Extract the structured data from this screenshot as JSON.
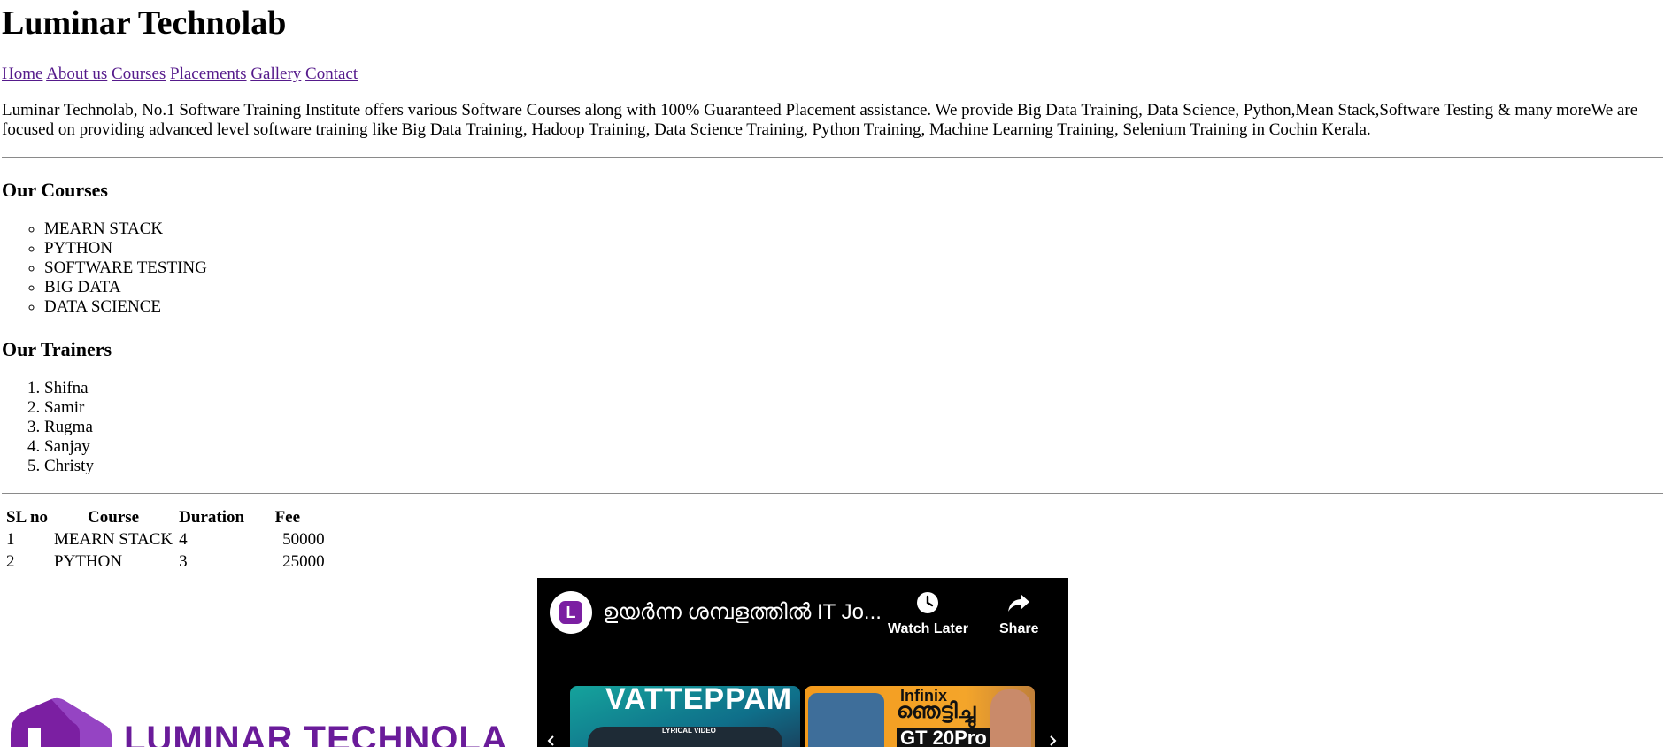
{
  "site": {
    "title": "Luminar Technolab"
  },
  "nav": {
    "items": [
      "Home",
      "About us",
      "Courses",
      "Placements",
      "Gallery",
      "Contact"
    ]
  },
  "intro": {
    "text": "Luminar Technolab, No.1 Software Training Institute offers various Software Courses along with 100% Guaranteed Placement assistance. We provide Big Data Training, Data Science, Python,Mean Stack,Software Testing & many moreWe are focused on providing advanced level software training like Big Data Training, Hadoop Training, Data Science Training, Python Training, Machine Learning Training, Selenium Training in Cochin Kerala."
  },
  "courses": {
    "heading": "Our Courses",
    "items": [
      "MEARN STACK",
      "PYTHON",
      "SOFTWARE TESTING",
      "BIG DATA",
      "DATA SCIENCE"
    ]
  },
  "trainers": {
    "heading": "Our Trainers",
    "items": [
      "Shifna",
      "Samir",
      "Rugma",
      "Sanjay",
      "Christy"
    ]
  },
  "table": {
    "headers": [
      "SL no",
      "Course",
      "Duration",
      "Fee"
    ],
    "rows": [
      [
        "1",
        "MEARN STACK",
        "4",
        "50000"
      ],
      [
        "2",
        "PYTHON",
        "3",
        "25000"
      ]
    ]
  },
  "logo": {
    "text": "LUMINAR TECHNOLAB",
    "color": "#6a1b9a"
  },
  "video": {
    "channel_initial": "L",
    "title": "ഉയർന്ന ശമ്പളത്തിൽ IT Jo...",
    "watch_later_label": "Watch Later",
    "share_label": "Share",
    "thumb1_title": "VATTEPPAM",
    "thumb1_sub": "LYRICAL VIDEO",
    "thumb2_brand": "Infinix",
    "thumb2_line": "ഞെട്ടിച്ചു",
    "thumb2_model": "GT 20Pro"
  },
  "colors": {
    "link": "#551a8b",
    "video_bg": "#000000",
    "brand_purple": "#7b1fa2"
  }
}
